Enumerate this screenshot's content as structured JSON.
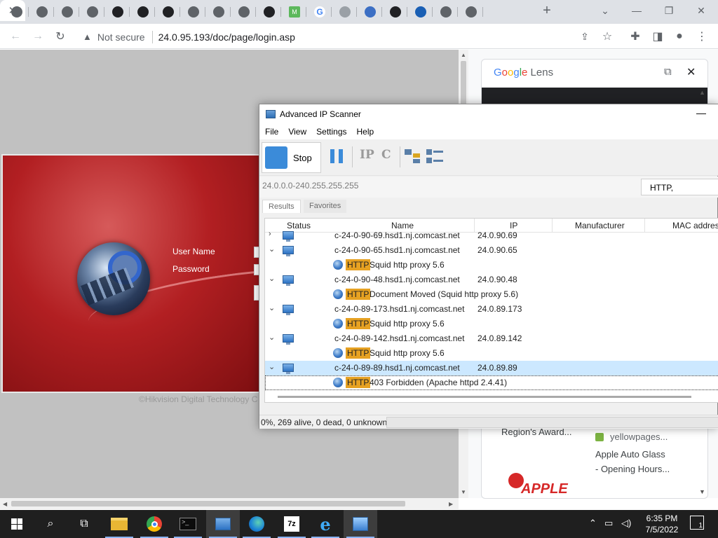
{
  "browser": {
    "tabs": [
      {
        "icon": "tab-favicon-1",
        "color": "#5f6368"
      },
      {
        "icon": "tab-favicon-2",
        "color": "#5f6368"
      },
      {
        "icon": "tab-favicon-3",
        "color": "#5f6368"
      },
      {
        "icon": "tab-favicon-4",
        "color": "#5f6368"
      },
      {
        "icon": "tab-favicon-5",
        "color": "#202124"
      },
      {
        "icon": "tab-favicon-6",
        "color": "#202124"
      },
      {
        "icon": "tab-favicon-7",
        "color": "#202124"
      },
      {
        "icon": "tab-favicon-8",
        "color": "#5f6368"
      },
      {
        "icon": "tab-favicon-9",
        "color": "#5f6368"
      },
      {
        "icon": "tab-favicon-10",
        "color": "#5f6368"
      },
      {
        "icon": "tab-favicon-11",
        "color": "#202124"
      },
      {
        "icon": "tab-favicon-12",
        "color": "#5cb85c"
      },
      {
        "icon": "tab-favicon-13",
        "color": "#4285f4"
      },
      {
        "icon": "tab-favicon-14",
        "color": "#9aa0a6"
      },
      {
        "icon": "tab-favicon-15",
        "color": "#3c6fc4"
      },
      {
        "icon": "tab-favicon-16",
        "color": "#202124"
      },
      {
        "icon": "tab-favicon-17",
        "color": "#1a5fb4"
      },
      {
        "icon": "tab-favicon-18",
        "color": "#5f6368"
      },
      {
        "icon": "tab-favicon-19",
        "color": "#5f6368"
      }
    ],
    "tab_letter_m": "M",
    "tab_letter_g": "G",
    "close_glyph": "✕",
    "new_tab_glyph": "+",
    "security_label": "Not secure",
    "url": "24.0.95.193/doc/page/login.asp"
  },
  "login_page": {
    "user_label": "User Name",
    "password_label": "Password",
    "copyright": "©Hikvision Digital Technology C"
  },
  "lens": {
    "title_parts": [
      "G",
      "o",
      "o",
      "g",
      "l",
      "e"
    ],
    "title_suffix": " Lens",
    "result1": "Region's Award...",
    "result2_source": "yellowpages...",
    "result2_title_line1": "Apple Auto Glass",
    "result2_title_line2": "- Opening Hours...",
    "logo_word": "APPLE"
  },
  "scanner": {
    "title": "Advanced IP Scanner",
    "menu": [
      "File",
      "View",
      "Settings",
      "Help"
    ],
    "stop_label": "Stop",
    "range": "24.0.0.0-240.255.255.255",
    "search_value": "HTTP,",
    "tabs": [
      "Results",
      "Favorites"
    ],
    "columns": [
      "Status",
      "Name",
      "IP",
      "Manufacturer",
      "MAC addres"
    ],
    "rows": [
      {
        "type": "host",
        "name": "c-24-0-90-69.hsd1.nj.comcast.net",
        "ip": "24.0.90.69",
        "chevron": "›"
      },
      {
        "type": "host",
        "name": "c-24-0-90-65.hsd1.nj.comcast.net",
        "ip": "24.0.90.65",
        "chevron": "⌄"
      },
      {
        "type": "service",
        "badge": "HTTP",
        "service": "Squid http proxy 5.6"
      },
      {
        "type": "host",
        "name": "c-24-0-90-48.hsd1.nj.comcast.net",
        "ip": "24.0.90.48",
        "chevron": "⌄"
      },
      {
        "type": "service",
        "badge": "HTTP",
        "service": "Document Moved (Squid http proxy 5.6)"
      },
      {
        "type": "host",
        "name": "c-24-0-89-173.hsd1.nj.comcast.net",
        "ip": "24.0.89.173",
        "chevron": "⌄"
      },
      {
        "type": "service",
        "badge": "HTTP",
        "service": "Squid http proxy 5.6"
      },
      {
        "type": "host",
        "name": "c-24-0-89-142.hsd1.nj.comcast.net",
        "ip": "24.0.89.142",
        "chevron": "⌄"
      },
      {
        "type": "service",
        "badge": "HTTP",
        "service": "Squid http proxy 5.6"
      },
      {
        "type": "host",
        "name": "c-24-0-89-89.hsd1.nj.comcast.net",
        "ip": "24.0.89.89",
        "chevron": "⌄",
        "selected": true
      },
      {
        "type": "service",
        "badge": "HTTP",
        "service": "403 Forbidden (Apache httpd 2.4.41)",
        "focused": true
      }
    ],
    "status": "0%, 269 alive, 0 dead, 0 unknown"
  },
  "taskbar": {
    "time": "6:35 PM",
    "date": "7/5/2022",
    "notification_count": "1",
    "app_7z": "7z"
  }
}
